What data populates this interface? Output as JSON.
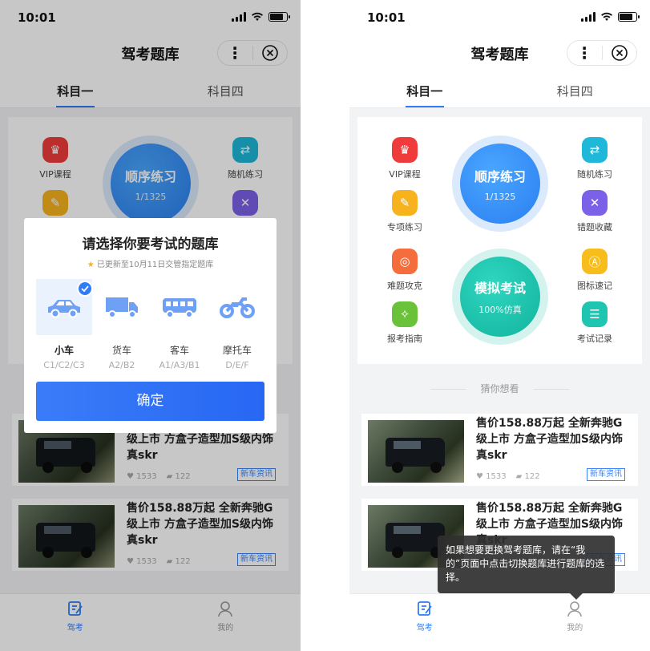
{
  "status": {
    "time": "10:01"
  },
  "nav": {
    "title": "驾考题库"
  },
  "tabs": [
    "科目一",
    "科目四"
  ],
  "grid": {
    "vip": "VIP课程",
    "random": "随机练习",
    "special": "专项练习",
    "wrong": "错题收藏",
    "hard": "难题攻克",
    "signs": "图标速记",
    "guide": "报考指南",
    "records": "考试记录",
    "sequential": {
      "title": "顺序练习",
      "progress": "1/1325"
    },
    "mock": {
      "title": "模拟考试",
      "sub": "100%仿真"
    }
  },
  "guess_label": "猜你想看",
  "news": [
    {
      "title": "售价158.88万起 全新奔驰G级上市 方盒子造型加S级内饰真skr",
      "likes": "1533",
      "comments": "122",
      "tag": "新车资讯"
    },
    {
      "title": "售价158.88万起 全新奔驰G级上市 方盒子造型加S级内饰真skr",
      "likes": "1533",
      "comments": "122",
      "tag": "新车资讯"
    }
  ],
  "bottom_tabs": {
    "exam": "驾考",
    "mine": "我的"
  },
  "modal": {
    "title": "请选择你要考试的题库",
    "subtitle": "已更新至10月11日交管指定题库",
    "options": [
      {
        "name": "小车",
        "code": "C1/C2/C3"
      },
      {
        "name": "货车",
        "code": "A2/B2"
      },
      {
        "name": "客车",
        "code": "A1/A3/B1"
      },
      {
        "name": "摩托车",
        "code": "D/E/F"
      }
    ],
    "confirm": "确定"
  },
  "tooltip": "如果想要更换驾考题库，请在“我的”页面中点击切换题库进行题库的选择。",
  "colors": {
    "accent": "#2f7cf6",
    "vip": "#ef3b3b",
    "random": "#1fb8d8",
    "special": "#f6b31e",
    "wrong": "#7b61e7",
    "hard": "#f56c3d",
    "signs": "#f7bd1b",
    "guide": "#6ac23b",
    "records": "#1ec6b1"
  }
}
